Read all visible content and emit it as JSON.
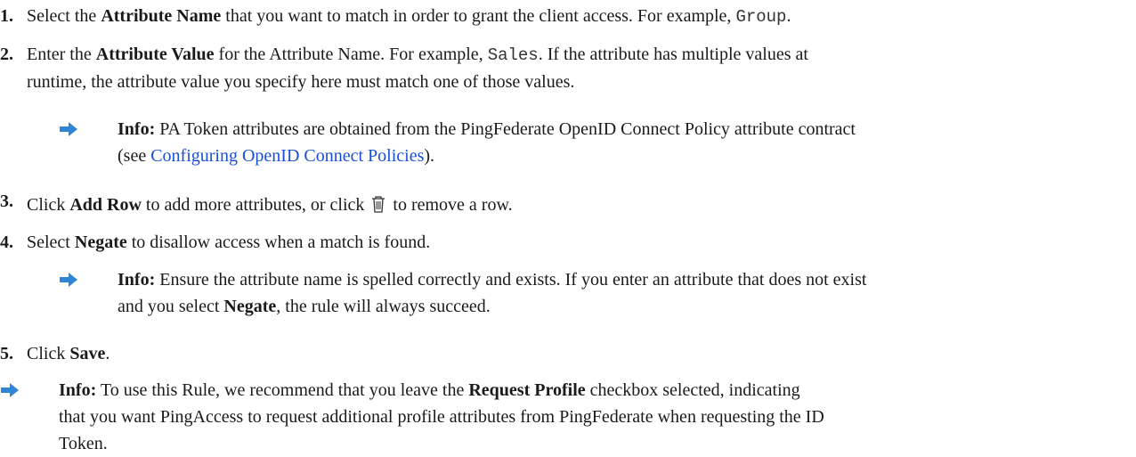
{
  "steps": [
    {
      "num": "1.",
      "pre": "Select the ",
      "bold": "Attribute Name",
      "mid": " that you want to match in order to grant the client access. For example, ",
      "code": "Group",
      "post": "."
    },
    {
      "num": "2.",
      "pre": "Enter the ",
      "bold": "Attribute Value",
      "mid": " for the Attribute Name. For example, ",
      "code": "Sales",
      "post": ". If the attribute has multiple values at",
      "line2": "runtime, the attribute value you specify here must match one of those values."
    },
    {
      "num": "3.",
      "pre": "Click ",
      "bold": "Add Row",
      "mid": " to add more attributes, or click ",
      "post": " to remove a row."
    },
    {
      "num": "4.",
      "pre": "Select ",
      "bold": "Negate",
      "post": " to disallow access when a match is found."
    },
    {
      "num": "5.",
      "pre": "Click ",
      "bold": "Save",
      "post": "."
    }
  ],
  "notes": {
    "note1": {
      "label": "Info:",
      "line1": " PA Token attributes are obtained from the PingFederate OpenID Connect Policy attribute contract",
      "line2_pre": "(see ",
      "link": "Configuring OpenID Connect Policies",
      "line2_post": ")."
    },
    "note2": {
      "label": "Info:",
      "line1": " Ensure the attribute name is spelled correctly and exists. If you enter an attribute that does not exist",
      "line2_pre": "and you select ",
      "bold": "Negate",
      "line2_post": ", the rule will always succeed."
    },
    "note3": {
      "label": "Info:",
      "line1_pre": " To use this Rule, we recommend that you leave the ",
      "bold": "Request Profile",
      "line1_post": " checkbox selected, indicating",
      "line2": "that you want PingAccess to request additional profile attributes from PingFederate when requesting the ID",
      "line3": "Token."
    }
  },
  "icons": {
    "arrow": "right-arrow-icon",
    "trash": "trash-icon",
    "arrow_color": "#2f86d6"
  }
}
